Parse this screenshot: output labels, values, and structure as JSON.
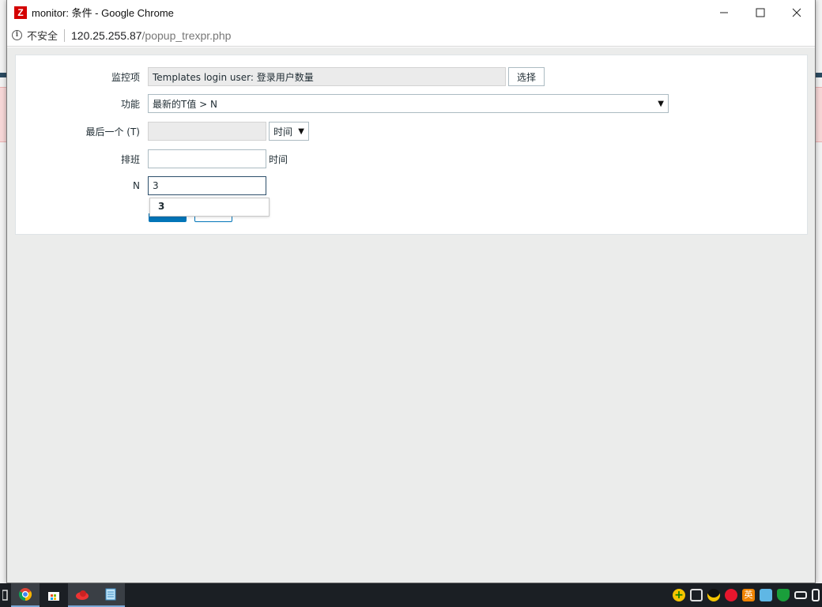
{
  "window": {
    "app_icon_letter": "Z",
    "title": "monitor: 条件 - Google Chrome",
    "controls": [
      "—",
      "☐",
      "✕"
    ]
  },
  "addressbar": {
    "security_label": "不安全",
    "host": "120.25.255.87",
    "path": "/popup_trexpr.php"
  },
  "form": {
    "item": {
      "label": "监控项",
      "value": "Templates login user: 登录用户数量",
      "button": "选择"
    },
    "function": {
      "label": "功能",
      "value": "最新的T值 > N"
    },
    "last": {
      "label": "最后一个 (T)",
      "value": "",
      "unit": "时间"
    },
    "shift": {
      "label": "排班",
      "value": "",
      "suffix": "时间"
    },
    "n": {
      "label": "N",
      "value": "3"
    },
    "autocomplete": [
      "3"
    ]
  },
  "colors": {
    "primary_button": "#0275b8",
    "page_background": "#ebeceb",
    "app_icon": "#d40000"
  },
  "taskbar": {
    "apps": [
      "explorer-icon",
      "chrome-icon",
      "store-icon",
      "snail-app-icon",
      "notepad-icon"
    ],
    "tray": [
      "add-icon",
      "network-icon",
      "qq-icon",
      "weibo-icon",
      "ime-icon",
      "keyboard-icon",
      "shield-icon",
      "battery-icon",
      "display-icon"
    ]
  }
}
